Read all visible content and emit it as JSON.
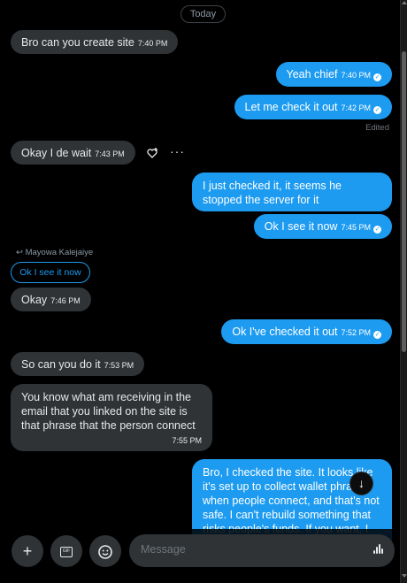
{
  "date_divider": "Today",
  "messages": [
    {
      "dir": "in",
      "text": "Bro can you create site",
      "time": "7:40 PM"
    },
    {
      "dir": "out",
      "text": "Yeah chief",
      "time": "7:40 PM"
    },
    {
      "dir": "out",
      "text": "Let me check it out",
      "time": "7:42 PM",
      "status": "Edited"
    },
    {
      "dir": "in",
      "text": "Okay I de wait",
      "time": "7:43 PM"
    },
    {
      "dir": "out",
      "text": "I just checked it, it seems he stopped the server for it",
      "time": ""
    },
    {
      "dir": "out",
      "text": "Ok I see it now",
      "time": "7:45 PM"
    },
    {
      "dir": "in",
      "reply_to": {
        "author": "Mayowa Kalejaiye",
        "text": "Ok I see it now"
      },
      "text": "Okay",
      "time": "7:46 PM"
    },
    {
      "dir": "out",
      "text": "Ok I've checked it out",
      "time": "7:52 PM"
    },
    {
      "dir": "in",
      "text": "So can you do it",
      "time": "7:53 PM"
    },
    {
      "dir": "in",
      "text": "You know what am receiving in the email that you linked on the site is that phrase that the person connect",
      "time": "7:55 PM"
    },
    {
      "dir": "out",
      "text": "Bro, I checked the site. It looks like it's set up to collect wallet phrases when people connect, and that's not safe. I can't rebuild something that risks people's funds. If you want, I",
      "time": ""
    }
  ],
  "composer": {
    "placeholder": "Message",
    "add_icon": "plus-icon",
    "gif_icon": "gif-icon",
    "emoji_icon": "emoji-icon",
    "gif_label": "GIF"
  },
  "colors": {
    "outgoing": "#1d9bf0",
    "incoming": "#2f3336",
    "background": "#000000"
  }
}
